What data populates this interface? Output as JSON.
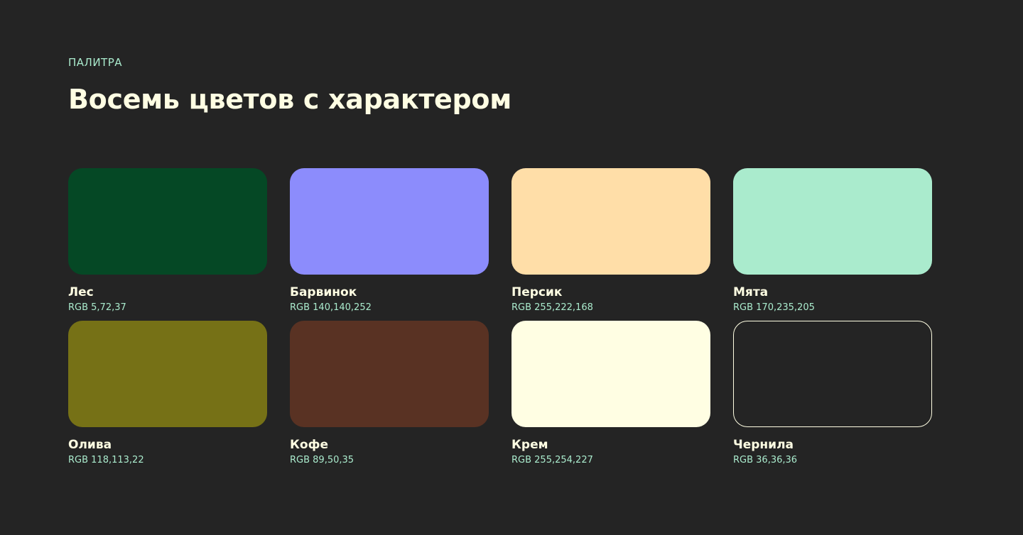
{
  "header": {
    "eyebrow": "ПАЛИТРА",
    "title": "Восемь цветов с характером"
  },
  "theme": {
    "background": "#242424",
    "text_primary": "#fffee3",
    "text_accent": "#aaebcd"
  },
  "swatches": [
    {
      "name": "Лес",
      "rgb": "RGB 5,72,37",
      "color": "#054825"
    },
    {
      "name": "Барвинок",
      "rgb": "RGB 140,140,252",
      "color": "#8c8cfc"
    },
    {
      "name": "Персик",
      "rgb": "RGB 255,222,168",
      "color": "#ffdea8"
    },
    {
      "name": "Мята",
      "rgb": "RGB 170,235,205",
      "color": "#aaebcd"
    },
    {
      "name": "Олива",
      "rgb": "RGB 118,113,22",
      "color": "#767116"
    },
    {
      "name": "Кофе",
      "rgb": "RGB 89,50,35",
      "color": "#593223"
    },
    {
      "name": "Крем",
      "rgb": "RGB 255,254,227",
      "color": "#fffee3"
    },
    {
      "name": "Чернила",
      "rgb": "RGB 36,36,36",
      "color": "#242424",
      "outlined": true
    }
  ]
}
